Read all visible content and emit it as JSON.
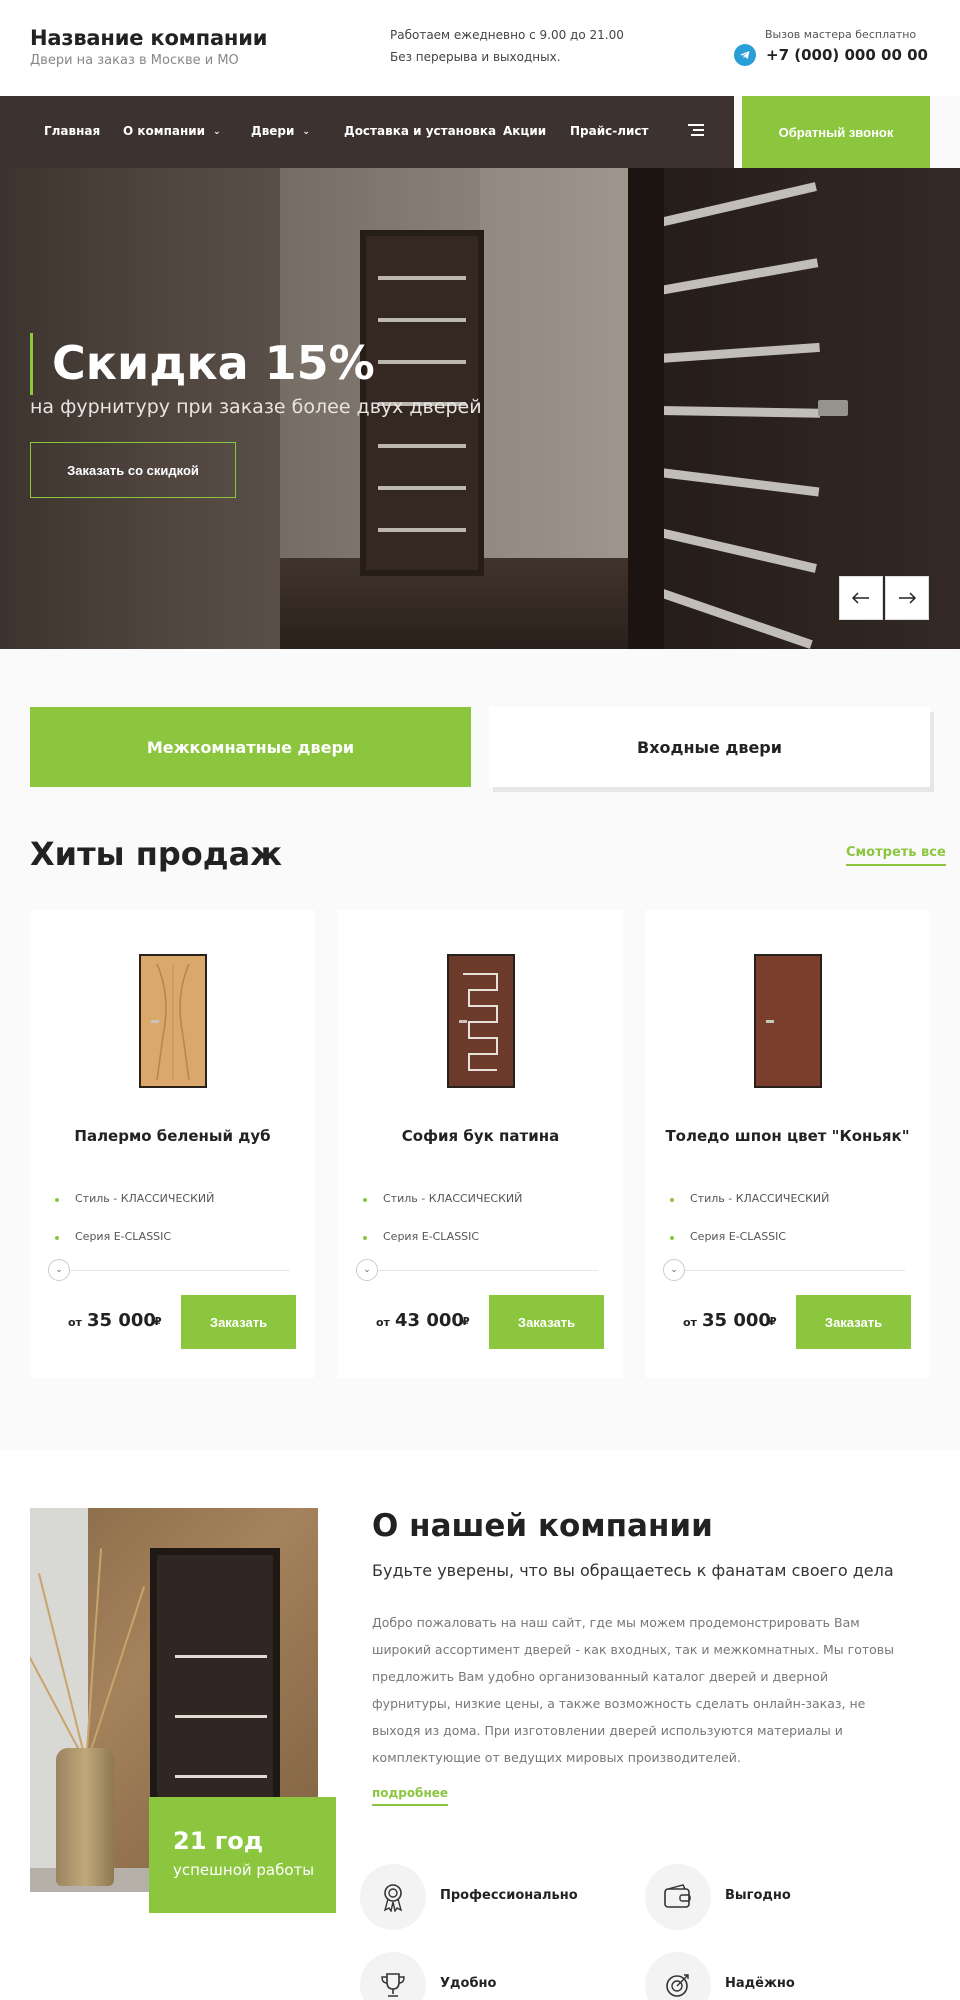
{
  "header": {
    "company_name": "Название компании",
    "tagline": "Двери на заказ в Москве и МО",
    "hours_line1": "Работаем ежедневно с 9.00 до 21.00",
    "hours_line2": "Без перерыва и выходных.",
    "call_note": "Вызов мастера бесплатно",
    "phone": "+7 (000) 000 00 00",
    "telegram_icon": "telegram-icon"
  },
  "nav": {
    "items": [
      {
        "label": "Главная",
        "has_dropdown": false
      },
      {
        "label": "О компании",
        "has_dropdown": true
      },
      {
        "label": "Двери",
        "has_dropdown": true
      },
      {
        "label": "Доставка и установка",
        "has_dropdown": false
      },
      {
        "label": "Акции",
        "has_dropdown": false
      },
      {
        "label": "Прайс-лист",
        "has_dropdown": false
      }
    ],
    "menu_icon": "menu-icon",
    "callback_label": "Обратный звонок"
  },
  "hero": {
    "title": "Скидка 15%",
    "subtitle": "на фурнитуру при заказе более двух дверей",
    "button_label": "Заказать со скидкой",
    "prev_icon": "arrow-left-icon",
    "next_icon": "arrow-right-icon"
  },
  "categories": [
    {
      "label": "Межкомнатные двери",
      "active": true
    },
    {
      "label": "Входные двери",
      "active": false
    }
  ],
  "hits": {
    "title": "Хиты продаж",
    "see_all": "Смотреть все",
    "products": [
      {
        "name": "Палермо беленый дуб",
        "feature1": "Стиль - КЛАССИЧЕСКИЙ",
        "feature2": "Серия E-CLASSIC",
        "price_prefix": "от",
        "price": "35 000",
        "currency": "₽",
        "order_label": "Заказать",
        "color": "#d9a86a"
      },
      {
        "name": "София бук патина",
        "feature1": "Стиль - КЛАССИЧЕСКИЙ",
        "feature2": "Серия E-CLASSIC",
        "price_prefix": "от",
        "price": "43 000",
        "currency": "₽",
        "order_label": "Заказать",
        "color": "#6b3a2a"
      },
      {
        "name": "Толедо шпон цвет \"Коньяк\"",
        "feature1": "Стиль - КЛАССИЧЕСКИЙ",
        "feature2": "Серия E-CLASSIC",
        "price_prefix": "от",
        "price": "35 000",
        "currency": "₽",
        "order_label": "Заказать",
        "color": "#7a3f2c"
      }
    ]
  },
  "about": {
    "title": "О нашей компании",
    "lead": "Будьте уверены, что вы обращаетесь к фанатам своего дела",
    "text": "Добро пожаловать на наш сайт, где мы можем продемонстрировать Вам широкий ассортимент дверей - как входных, так и межкомнатных. Мы готовы предложить Вам удобно организованный каталог дверей и дверной фурнитуры, низкие цены, а также возможность сделать онлайн-заказ, не выходя из дома. При изготовлении дверей используются материалы и комплектующие от ведущих мировых производителей.",
    "more": "подробнее",
    "years_num": "21 год",
    "years_text": "успешной работы",
    "advantages": [
      {
        "label": "Профессионально",
        "icon": "award-icon"
      },
      {
        "label": "Выгодно",
        "icon": "wallet-icon"
      },
      {
        "label": "Удобно",
        "icon": "trophy-icon"
      },
      {
        "label": "Надёжно",
        "icon": "target-icon"
      }
    ]
  },
  "colors": {
    "accent": "#8cc63f",
    "nav_bg": "#3c3330",
    "telegram": "#2a9ed8"
  }
}
